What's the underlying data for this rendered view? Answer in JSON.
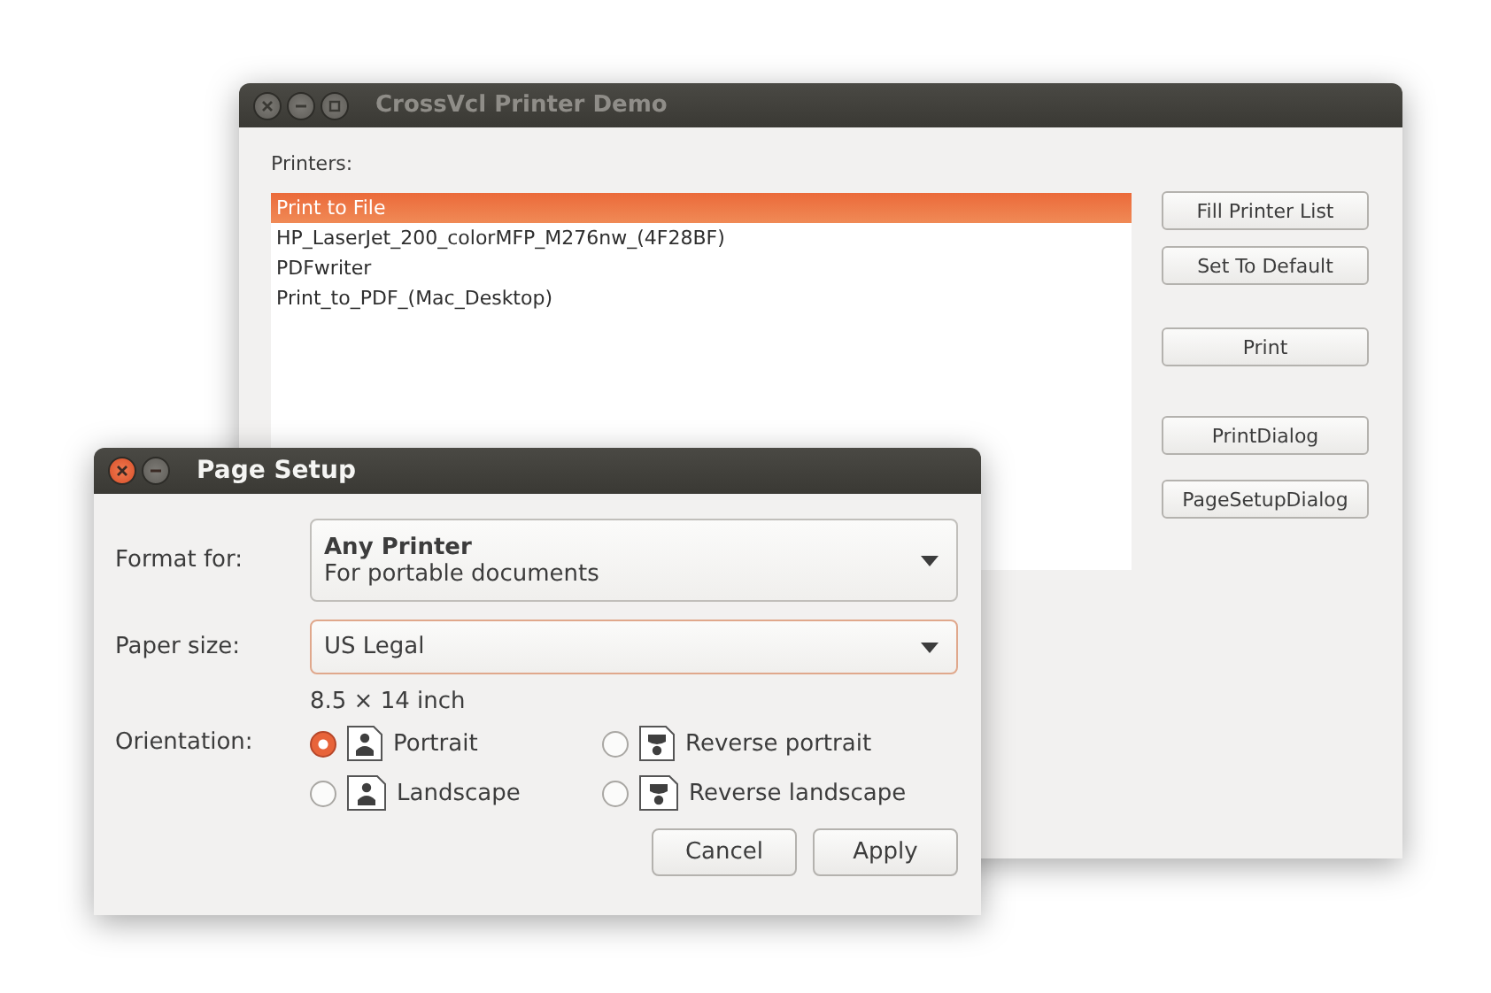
{
  "main_window": {
    "title": "CrossVcl Printer Demo",
    "active": false,
    "printers_label": "Printers:",
    "printers": [
      {
        "name": "Print to File",
        "selected": true
      },
      {
        "name": "HP_LaserJet_200_colorMFP_M276nw_(4F28BF)",
        "selected": false
      },
      {
        "name": "PDFwriter",
        "selected": false
      },
      {
        "name": "Print_to_PDF_(Mac_Desktop)",
        "selected": false
      }
    ],
    "buttons": [
      "Fill Printer List",
      "Set To Default",
      "Print",
      "PrintDialog",
      "PageSetupDialog"
    ]
  },
  "dialog": {
    "title": "Page Setup",
    "active": true,
    "format_label": "Format for:",
    "format_name": "Any Printer",
    "format_description": "For portable documents",
    "paper_label": "Paper size:",
    "paper_value": "US Legal",
    "paper_dimensions": "8.5 × 14 inch",
    "orientation_label": "Orientation:",
    "orientations": [
      {
        "label": "Portrait",
        "kind": "portrait",
        "selected": true
      },
      {
        "label": "Reverse portrait",
        "kind": "reverse-portrait",
        "selected": false
      },
      {
        "label": "Landscape",
        "kind": "landscape",
        "selected": false
      },
      {
        "label": "Reverse landscape",
        "kind": "reverse-landscape",
        "selected": false
      }
    ],
    "buttons": [
      "Cancel",
      "Apply"
    ]
  }
}
